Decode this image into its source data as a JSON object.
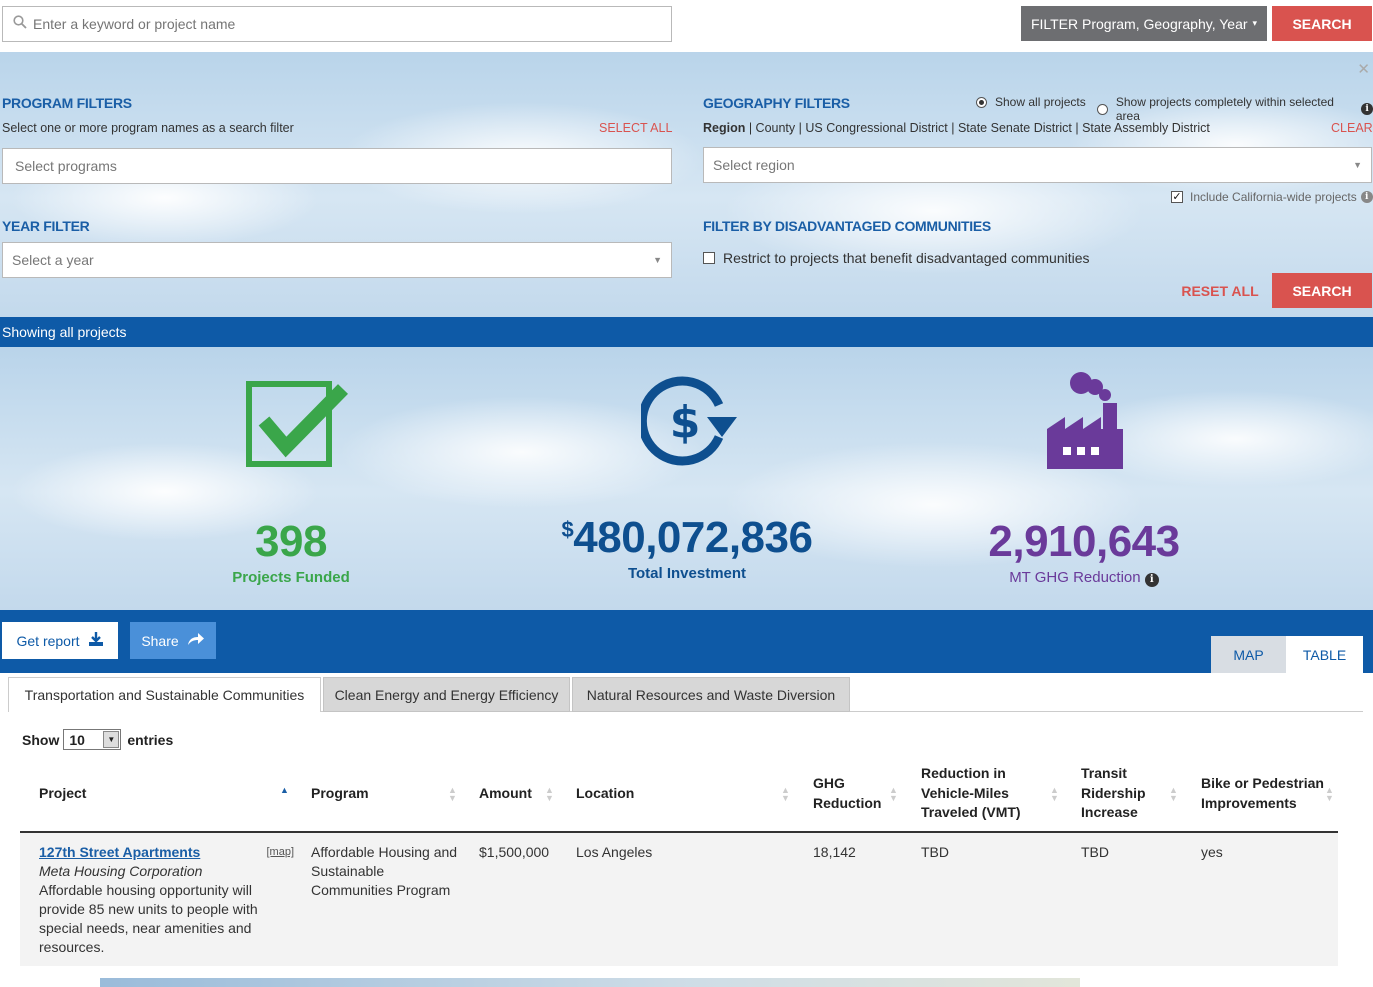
{
  "top_search": {
    "placeholder": "Enter a keyword or project name",
    "filter_toggle_label": "FILTER Program, Geography, Year",
    "search_label": "SEARCH"
  },
  "program_filters": {
    "title": "PROGRAM FILTERS",
    "hint": "Select one or more program names as a search filter",
    "select_all": "SELECT ALL",
    "placeholder": "Select programs"
  },
  "geography_filters": {
    "title": "GEOGRAPHY FILTERS",
    "radio_all": "Show all projects",
    "radio_within": "Show projects completely within selected area",
    "levels_first": "Region",
    "levels_rest": " | County | US Congressional District | State Senate District | State Assembly District",
    "clear": "CLEAR",
    "placeholder": "Select region",
    "include_ca": "Include California-wide projects"
  },
  "year_filter": {
    "title": "YEAR FILTER",
    "placeholder": "Select a year"
  },
  "dac_filter": {
    "title": "FILTER BY DISADVANTAGED COMMUNITIES",
    "checkbox_label": "Restrict to projects that benefit disadvantaged communities"
  },
  "reset_all": "RESET ALL",
  "filter_search": "SEARCH",
  "showing_text": "Showing all projects",
  "stats": {
    "projects": {
      "value": "398",
      "label": "Projects Funded",
      "color": "#3aa64a"
    },
    "investment": {
      "currency": "$",
      "value": "480,072,836",
      "label": "Total Investment",
      "color": "#0e4f8f"
    },
    "ghg": {
      "value": "2,910,643",
      "label": "MT GHG Reduction",
      "color": "#6a3a9a"
    }
  },
  "actions": {
    "get_report": "Get report",
    "share": "Share",
    "tab_map": "MAP",
    "tab_table": "TABLE"
  },
  "category_tabs": [
    "Transportation and Sustainable Communities",
    "Clean Energy and Energy Efficiency",
    "Natural Resources and Waste Diversion"
  ],
  "entries": {
    "show": "Show",
    "value": "10",
    "suffix": "entries"
  },
  "columns": {
    "project": "Project",
    "program": "Program",
    "amount": "Amount",
    "location": "Location",
    "ghg_1": "GHG",
    "ghg_2": "Reduction",
    "vmt_1": "Reduction in",
    "vmt_2": "Vehicle-Miles",
    "vmt_3": "Traveled (VMT)",
    "transit_1": "Transit",
    "transit_2": "Ridership",
    "transit_3": "Increase",
    "bike_1": "Bike or Pedestrian",
    "bike_2": "Improvements"
  },
  "rows": [
    {
      "name": "127th Street Apartments",
      "map_link": "[map]",
      "org": "Meta Housing Corporation",
      "desc_1": "Affordable housing opportunity will",
      "desc_2": "provide 85 new units to people with",
      "desc_3": "special needs, near amenities and",
      "desc_4": "resources.",
      "program_1": "Affordable Housing and",
      "program_2": "Sustainable",
      "program_3": "Communities Program",
      "amount": "$1,500,000",
      "location": "Los Angeles",
      "ghg": "18,142",
      "vmt": "TBD",
      "transit": "TBD",
      "bike": "yes"
    }
  ]
}
